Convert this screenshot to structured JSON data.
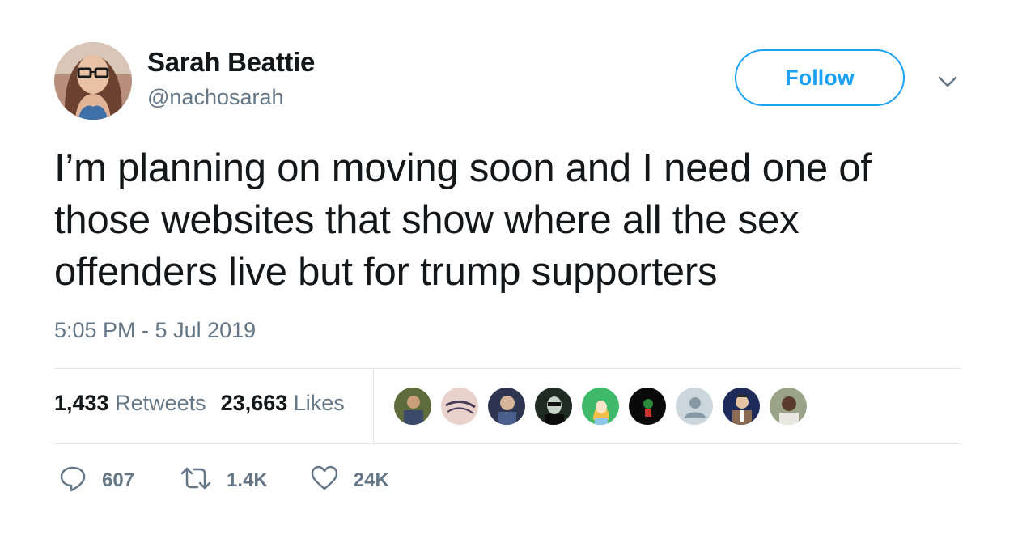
{
  "author": {
    "name": "Sarah Beattie",
    "handle": "@nachosarah"
  },
  "follow_label": "Follow",
  "tweet": {
    "text": "I’m planning on moving soon and I need one of those websites that show where all the sex offenders live but for trump supporters",
    "timestamp": "5:05 PM - 5 Jul 2019"
  },
  "stats": {
    "retweets_count": "1,433",
    "retweets_label": "Retweets",
    "likes_count": "23,663",
    "likes_label": "Likes"
  },
  "actions": {
    "replies": "607",
    "retweets": "1.4K",
    "likes": "24K"
  },
  "colors": {
    "accent": "#1da1f2",
    "muted": "#657786",
    "text": "#14171a",
    "divider": "#e1e8ed"
  },
  "icons": {
    "more": "chevron-down-icon",
    "reply": "speech-bubble-icon",
    "retweet": "retweet-arrows-icon",
    "like": "heart-icon"
  }
}
